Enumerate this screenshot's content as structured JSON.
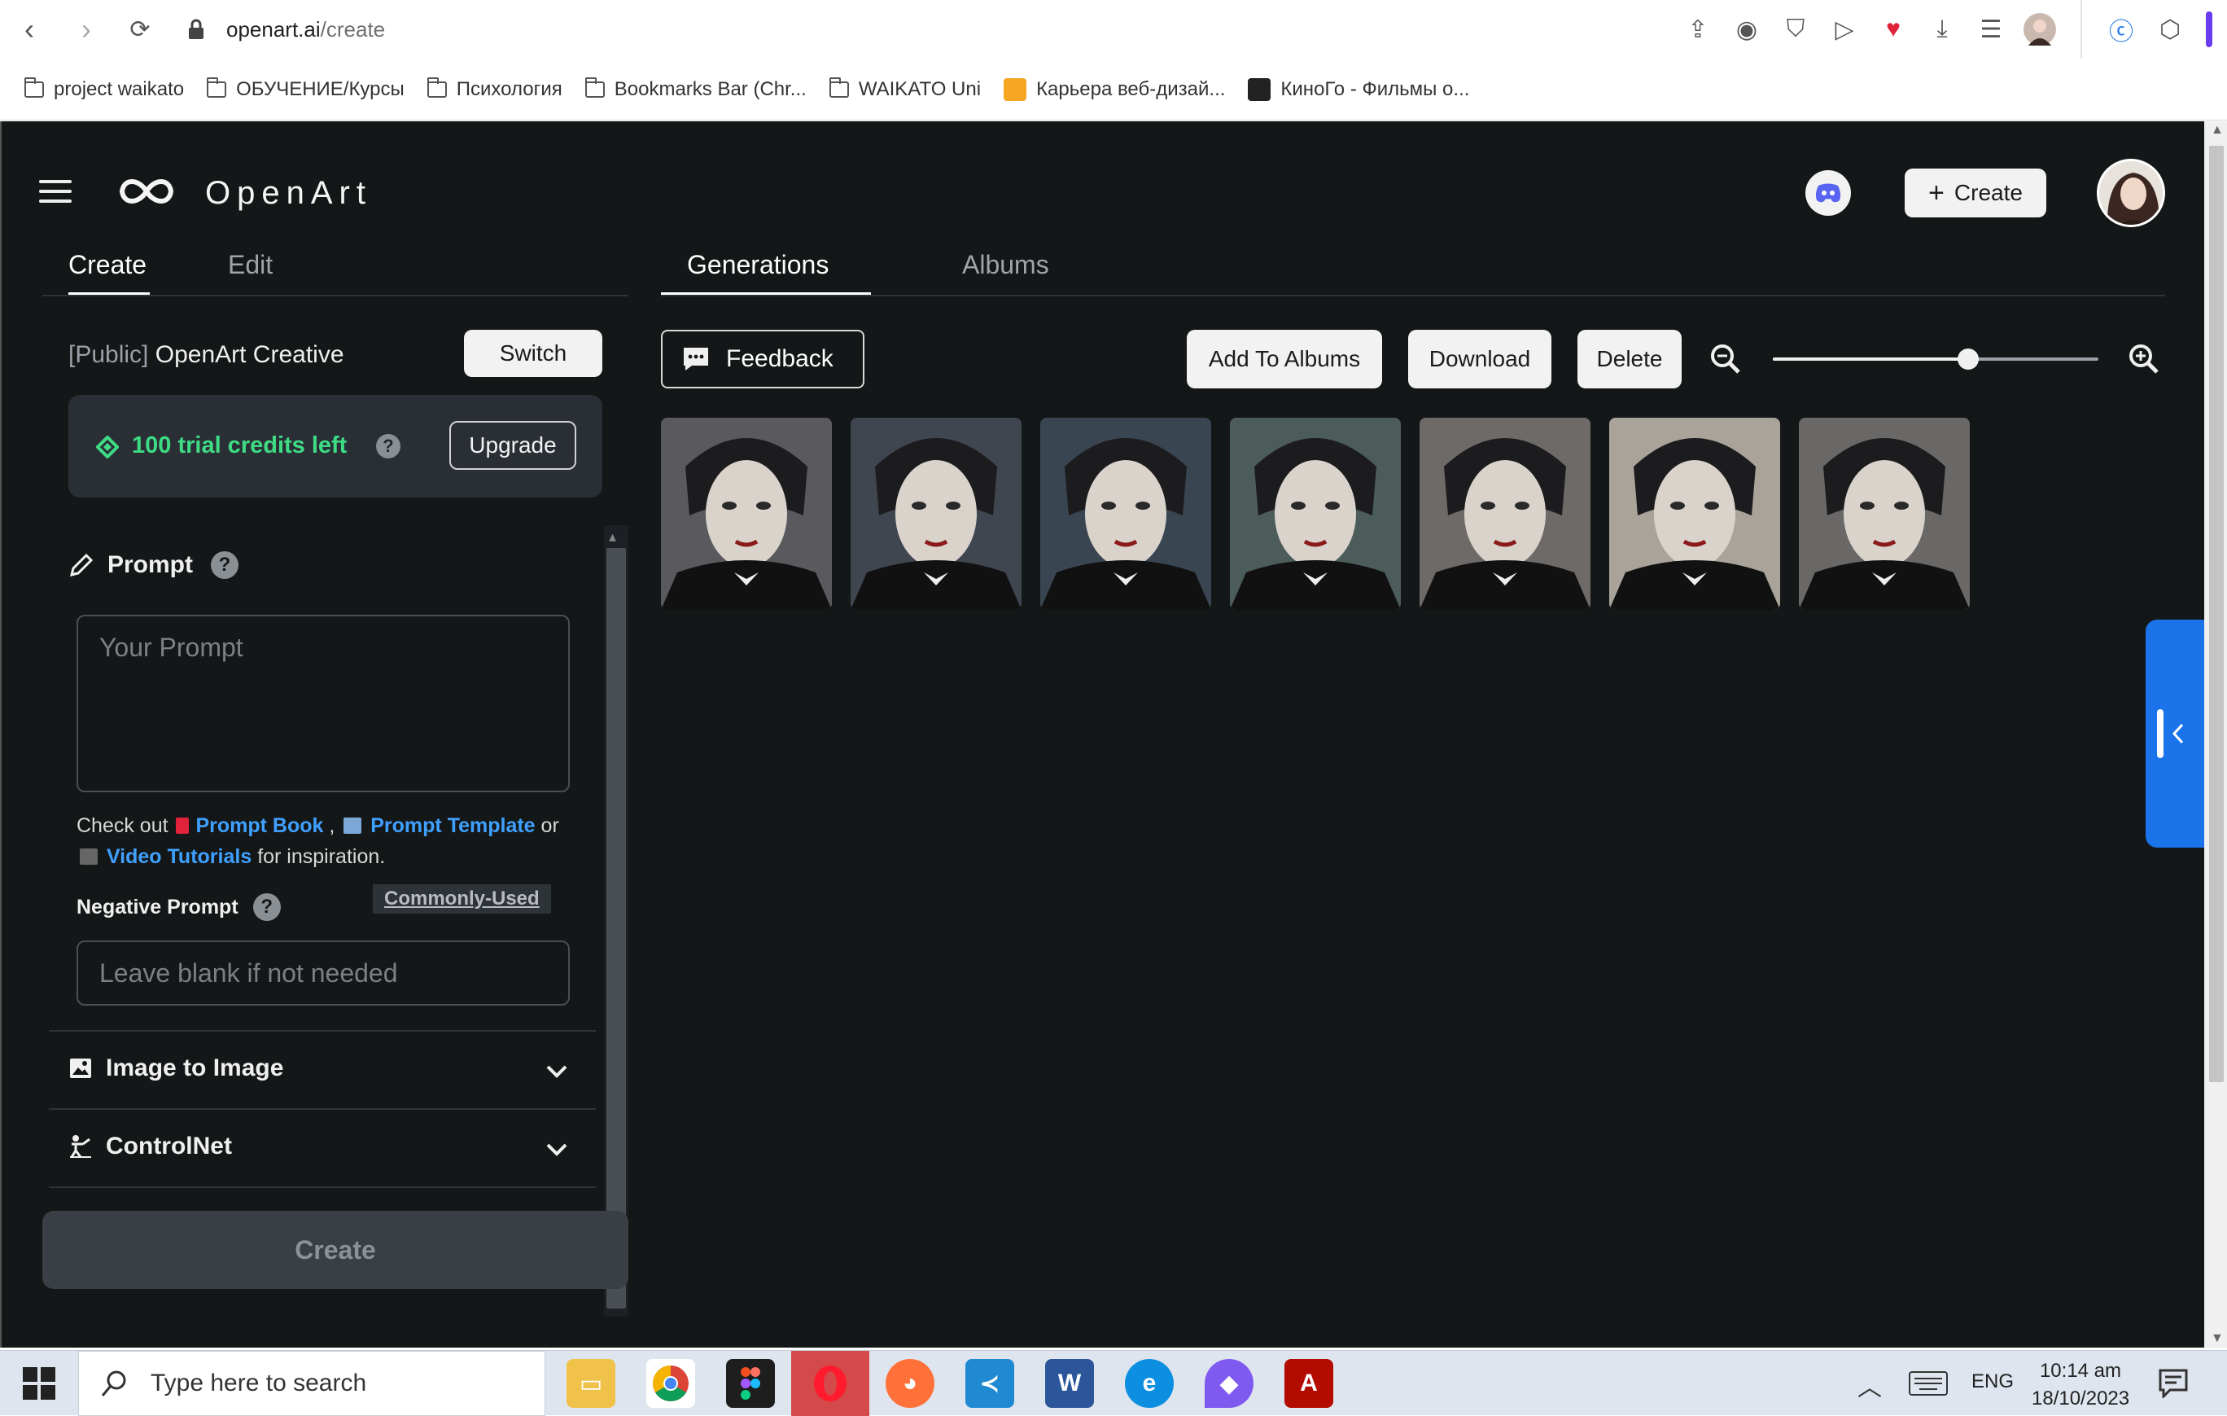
{
  "browser": {
    "url_host": "openart.ai",
    "url_path": "/create",
    "bookmarks": [
      {
        "label": "project waikato",
        "icon": "folder-icon"
      },
      {
        "label": "ОБУЧЕНИЕ/Курсы",
        "icon": "folder-icon"
      },
      {
        "label": "Психология",
        "icon": "folder-icon"
      },
      {
        "label": "Bookmarks Bar (Chr...",
        "icon": "folder-icon"
      },
      {
        "label": "WAIKATO Uni",
        "icon": "folder-icon"
      },
      {
        "label": "Карьера веб-дизай...",
        "icon": "site-favicon"
      },
      {
        "label": "КиноГо - Фильмы о...",
        "icon": "site-favicon"
      }
    ]
  },
  "header": {
    "brand": "OpenArt",
    "create_label": "Create"
  },
  "left_panel": {
    "tabs": [
      {
        "label": "Create",
        "active": true
      },
      {
        "label": "Edit",
        "active": false
      }
    ],
    "model_scope": "[Public]",
    "model_name": "OpenArt Creative",
    "switch_label": "Switch",
    "credits_text": "100 trial credits left",
    "upgrade_label": "Upgrade",
    "prompt": {
      "title": "Prompt",
      "placeholder": "Your Prompt",
      "help_prefix": "Check out",
      "link_prompt_book": "Prompt Book",
      "comma": ",",
      "link_prompt_template_1": "Prompt",
      "link_prompt_template_2": "Template",
      "or": "or",
      "link_video_tutorials": "Video Tutorials",
      "help_suffix": "for inspiration."
    },
    "negative_prompt": {
      "title": "Negative Prompt",
      "commonly_used": "Commonly-Used",
      "placeholder": "Leave blank if not needed"
    },
    "sections": [
      {
        "label": "Image to Image"
      },
      {
        "label": "ControlNet"
      }
    ],
    "create_button": "Create"
  },
  "main": {
    "tabs": [
      {
        "label": "Generations",
        "active": true
      },
      {
        "label": "Albums",
        "active": false
      }
    ],
    "feedback_label": "Feedback",
    "add_to_albums_label": "Add To Albums",
    "download_label": "Download",
    "delete_label": "Delete",
    "zoom_level": 0.6,
    "images": [
      {
        "tone": "#5a5a5e"
      },
      {
        "tone": "#3f4650"
      },
      {
        "tone": "#3a4552"
      },
      {
        "tone": "#4c5c5a"
      },
      {
        "tone": "#6e6a68"
      },
      {
        "tone": "#a9a39a"
      },
      {
        "tone": "#6a6866"
      }
    ]
  },
  "taskbar": {
    "search_placeholder": "Type here to search",
    "language": "ENG",
    "time": "10:14 am",
    "date": "18/10/2023"
  },
  "colors": {
    "app_bg": "#141718",
    "panel_bg": "#22272c",
    "credits_green": "#3ddc84",
    "link_blue": "#3fa0ff",
    "drawer_blue": "#1a73e8"
  }
}
